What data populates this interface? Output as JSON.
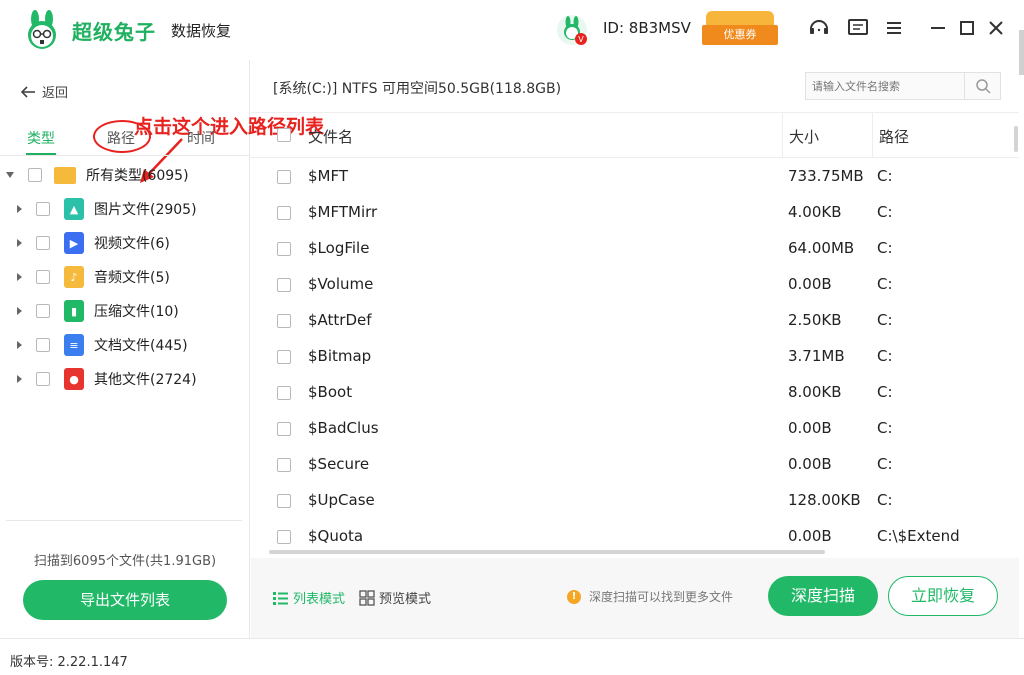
{
  "app": {
    "brand": "超级兔子",
    "brand_sub": "数据恢复",
    "user_id": "ID: 8B3MSV",
    "coupon_label": "优惠券",
    "version": "版本号:  2.22.1.147"
  },
  "icons": {
    "logo": "rabbit-logo",
    "avatar": "user-avatar-icon",
    "service": "customer-service-icon",
    "feedback": "feedback-icon",
    "menu": "menu-icon",
    "minimize": "minimize-icon",
    "maximize": "maximize-icon",
    "close": "close-icon"
  },
  "sidebar": {
    "back_label": "返回",
    "annotation": "点击这个进入路径列表",
    "tabs": [
      {
        "label": "类型",
        "active": true
      },
      {
        "label": "路径",
        "active": false
      },
      {
        "label": "时间",
        "active": false
      }
    ],
    "tree": [
      {
        "label": "所有类型(6095)",
        "icon": "folder-icon",
        "expanded": true
      },
      {
        "label": "图片文件(2905)",
        "icon": "image-file-icon",
        "color": "#2bc0a8"
      },
      {
        "label": "视频文件(6)",
        "icon": "video-file-icon",
        "color": "#3b6ef0"
      },
      {
        "label": "音频文件(5)",
        "icon": "audio-file-icon",
        "color": "#f5b93b"
      },
      {
        "label": "压缩文件(10)",
        "icon": "zip-file-icon",
        "color": "#21b868"
      },
      {
        "label": "文档文件(445)",
        "icon": "document-file-icon",
        "color": "#3b7ef0"
      },
      {
        "label": "其他文件(2724)",
        "icon": "other-file-icon",
        "color": "#e8342f"
      }
    ],
    "scan_info": "扫描到6095个文件(共1.91GB)",
    "export_label": "导出文件列表"
  },
  "main": {
    "path_info": "[系统(C:)] NTFS 可用空间50.5GB(118.8GB)",
    "search_placeholder": "请输入文件名搜索",
    "columns": {
      "name": "文件名",
      "size": "大小",
      "path": "路径"
    },
    "rows": [
      {
        "name": "$MFT",
        "size": "733.75MB",
        "path": "C:"
      },
      {
        "name": "$MFTMirr",
        "size": "4.00KB",
        "path": "C:"
      },
      {
        "name": "$LogFile",
        "size": "64.00MB",
        "path": "C:"
      },
      {
        "name": "$Volume",
        "size": "0.00B",
        "path": "C:"
      },
      {
        "name": "$AttrDef",
        "size": "2.50KB",
        "path": "C:"
      },
      {
        "name": "$Bitmap",
        "size": "3.71MB",
        "path": "C:"
      },
      {
        "name": "$Boot",
        "size": "8.00KB",
        "path": "C:"
      },
      {
        "name": "$BadClus",
        "size": "0.00B",
        "path": "C:"
      },
      {
        "name": "$Secure",
        "size": "0.00B",
        "path": "C:"
      },
      {
        "name": "$UpCase",
        "size": "128.00KB",
        "path": "C:"
      },
      {
        "name": "$Quota",
        "size": "0.00B",
        "path": "C:\\$Extend"
      }
    ],
    "list_mode": "列表模式",
    "preview_mode": "预览模式",
    "hint": "深度扫描可以找到更多文件",
    "deep_scan": "深度扫描",
    "recover": "立即恢复"
  },
  "colors": {
    "accent": "#21b868",
    "annotation": "#e8231f"
  }
}
